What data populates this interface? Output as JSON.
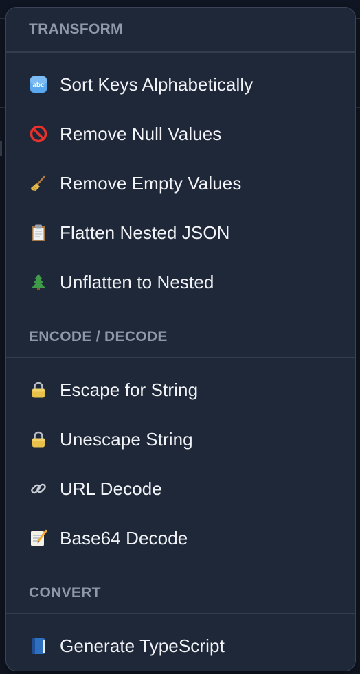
{
  "menu": {
    "sections": [
      {
        "title": "TRANSFORM",
        "items": [
          {
            "label": "Sort Keys Alphabetically",
            "icon": "abc-icon"
          },
          {
            "label": "Remove Null Values",
            "icon": "no-entry-icon"
          },
          {
            "label": "Remove Empty Values",
            "icon": "broom-icon"
          },
          {
            "label": "Flatten Nested JSON",
            "icon": "clipboard-icon"
          },
          {
            "label": "Unflatten to Nested",
            "icon": "tree-icon"
          }
        ]
      },
      {
        "title": "ENCODE / DECODE",
        "items": [
          {
            "label": "Escape for String",
            "icon": "lock-icon"
          },
          {
            "label": "Unescape String",
            "icon": "lock-icon"
          },
          {
            "label": "URL Decode",
            "icon": "link-icon"
          },
          {
            "label": "Base64 Decode",
            "icon": "memo-icon"
          }
        ]
      },
      {
        "title": "CONVERT",
        "items": [
          {
            "label": "Generate TypeScript",
            "icon": "blue-book-icon"
          }
        ]
      }
    ]
  },
  "colors": {
    "menu_background": "#1f2838",
    "section_header_text": "#8e98a8",
    "item_text": "#f1f3f6",
    "divider": "#333d4e"
  }
}
